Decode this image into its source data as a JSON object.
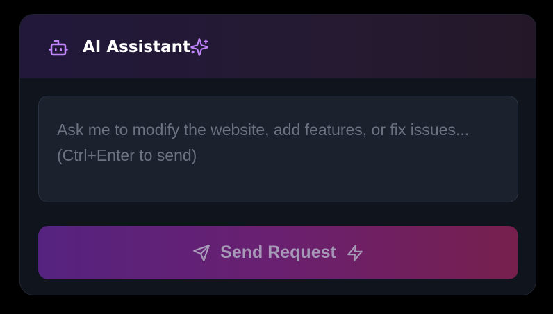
{
  "header": {
    "title": "AI Assistant",
    "icon": "robot-icon",
    "accent_icon": "sparkles-icon"
  },
  "input": {
    "value": "",
    "placeholder": "Ask me to modify the website, add features, or fix issues... (Ctrl+Enter to send)"
  },
  "send_button": {
    "label": "Send Request",
    "leading_icon": "send-icon",
    "trailing_icon": "bolt-icon"
  },
  "colors": {
    "accent": "#c084fc",
    "button_gradient_start": "#55237f",
    "button_gradient_end": "#77204e",
    "background": "#10141c"
  }
}
